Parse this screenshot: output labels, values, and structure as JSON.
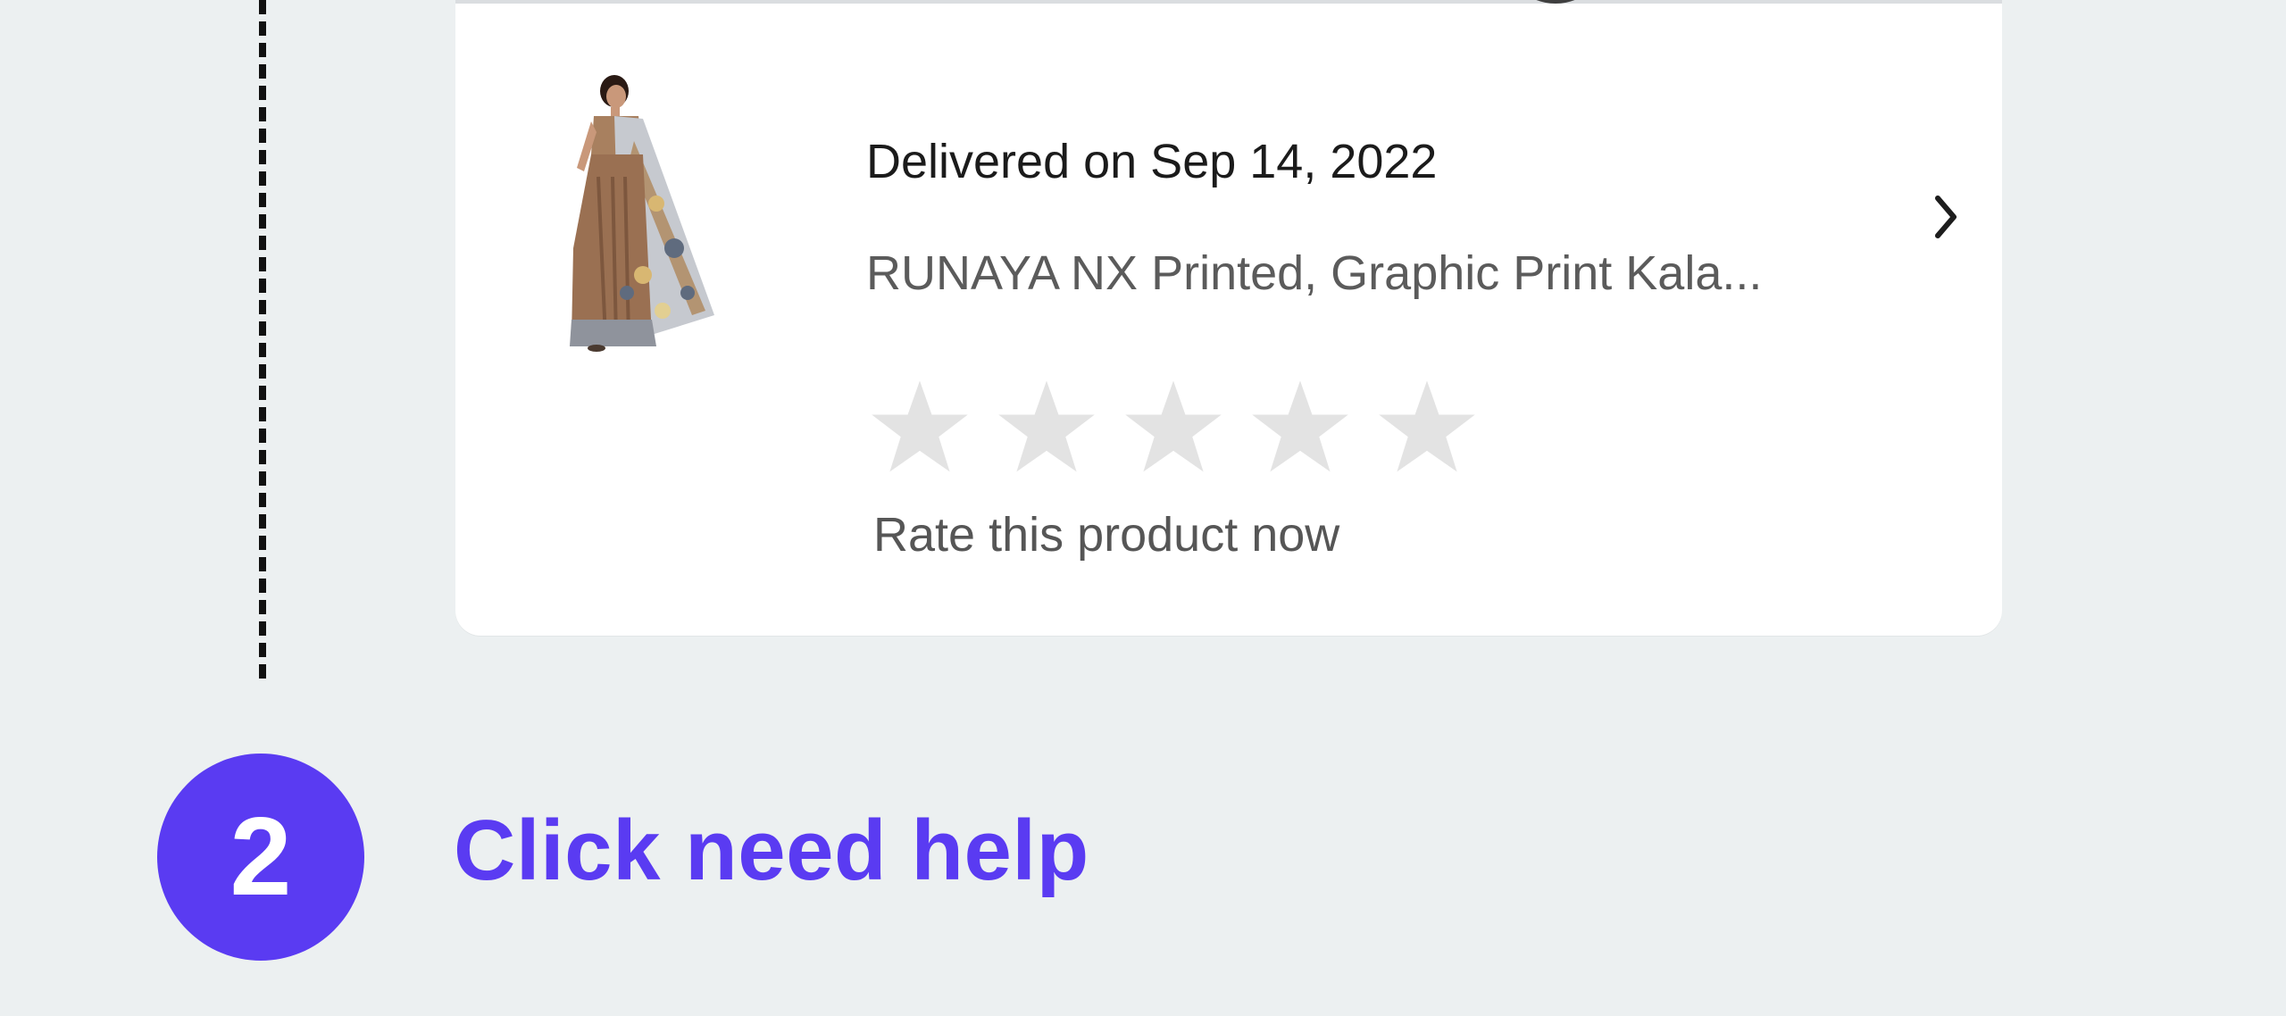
{
  "order": {
    "delivery_status": "Delivered on Sep 14, 2022",
    "product_title": "RUNAYA NX Printed, Graphic Print Kala...",
    "rating": {
      "max_stars": 5,
      "current_rating": 0,
      "empty_star_color": "#E3E3E3",
      "prompt": "Rate this product now"
    }
  },
  "step": {
    "number": "2",
    "instruction": "Click need help",
    "accent_color": "#5A3BF2"
  },
  "icons": {
    "chevron": "chevron-right-icon",
    "star": "star-icon"
  }
}
